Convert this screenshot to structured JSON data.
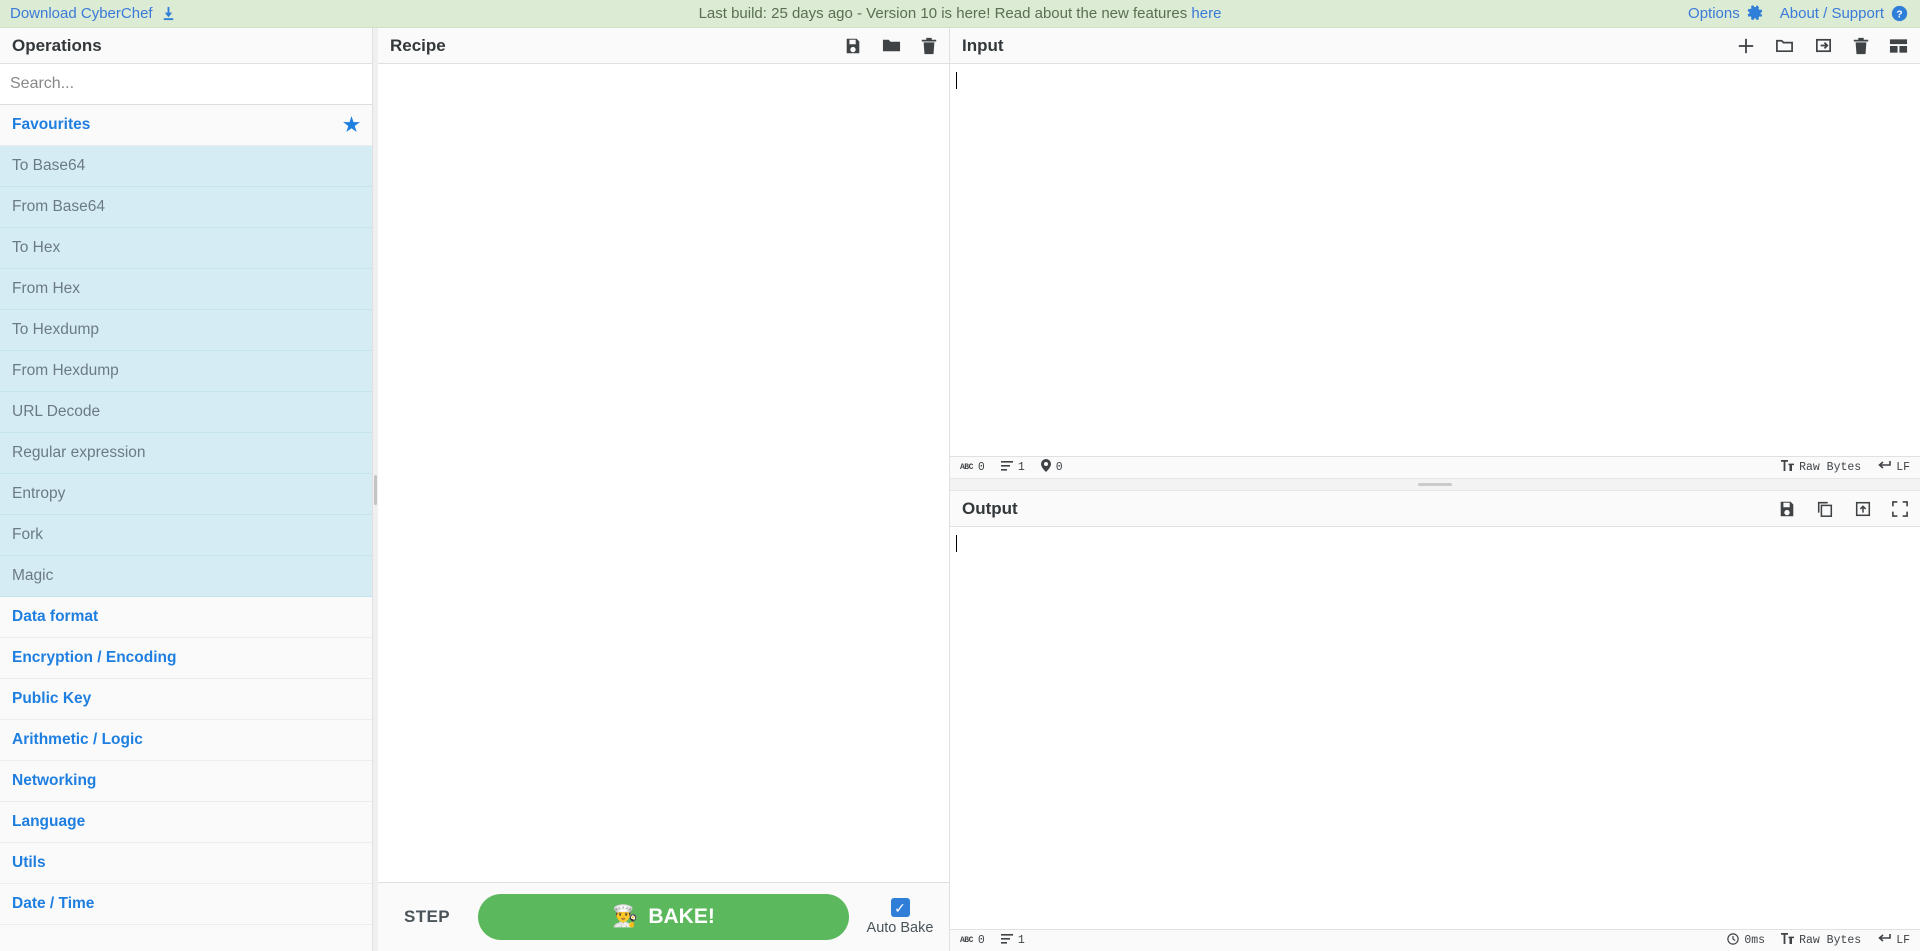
{
  "banner": {
    "download_label": "Download CyberChef",
    "download_icon": "download-icon",
    "notice_prefix": "Last build: 25 days ago - Version 10 is here! Read about the new features ",
    "notice_link": "here",
    "options_label": "Options",
    "options_icon": "gear-icon",
    "about_label": "About / Support",
    "about_icon": "question-circle-icon"
  },
  "operations": {
    "title": "Operations",
    "search_placeholder": "Search...",
    "search_value": "",
    "favourites": {
      "label": "Favourites",
      "icon": "star-icon",
      "items": [
        "To Base64",
        "From Base64",
        "To Hex",
        "From Hex",
        "To Hexdump",
        "From Hexdump",
        "URL Decode",
        "Regular expression",
        "Entropy",
        "Fork",
        "Magic"
      ]
    },
    "categories": [
      "Data format",
      "Encryption / Encoding",
      "Public Key",
      "Arithmetic / Logic",
      "Networking",
      "Language",
      "Utils",
      "Date / Time"
    ]
  },
  "recipe": {
    "title": "Recipe",
    "icons": [
      "save-icon",
      "folder-icon",
      "trash-icon"
    ],
    "steps": [],
    "controls": {
      "step_label": "STEP",
      "bake_label": "BAKE!",
      "bake_icon": "chef-icon",
      "bake_color": "#5cb85c",
      "auto_bake_label": "Auto Bake",
      "auto_bake_checked": true
    }
  },
  "input": {
    "title": "Input",
    "icons": [
      "plus-icon",
      "folder-open-icon",
      "import-icon",
      "trash-icon",
      "tabs-layout-icon"
    ],
    "value": "",
    "status": {
      "length_icon": "abc-icon",
      "length": "0",
      "lines_icon": "lines-icon",
      "lines": "1",
      "position_icon": "map-pin-icon",
      "position": "0",
      "encoding_icon": "font-icon",
      "encoding": "Raw Bytes",
      "line_ending_icon": "return-icon",
      "line_ending": "LF"
    }
  },
  "output": {
    "title": "Output",
    "icons": [
      "save-icon",
      "copy-icon",
      "open-in-tab-icon",
      "maximize-icon"
    ],
    "value": "",
    "status": {
      "length_icon": "abc-icon",
      "length": "0",
      "lines_icon": "lines-icon",
      "lines": "1",
      "timing_icon": "clock-icon",
      "timing": "0ms",
      "encoding_icon": "font-icon",
      "encoding": "Raw Bytes",
      "line_ending_icon": "return-icon",
      "line_ending": "LF"
    }
  }
}
